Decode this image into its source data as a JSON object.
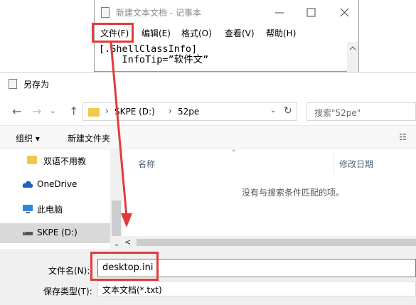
{
  "notepad": {
    "title": "新建文本文档 - 记事本",
    "menu": [
      "文件(F)",
      "编辑(E)",
      "格式(O)",
      "查看(V)",
      "帮助(H)"
    ],
    "lines": [
      "[.ShellClassInfo]",
      "    InfoTip=”软件文”"
    ],
    "controls": {
      "minimize": "—",
      "maximize": "☐",
      "close": "✕"
    }
  },
  "dialog": {
    "title": "另存为",
    "nav": {
      "back": "←",
      "forward": "→",
      "up": "↑"
    },
    "address": {
      "crumbs": [
        "SKPE (D:)",
        "52pe"
      ],
      "separator": "›",
      "dropdown": "⌄",
      "refresh": "↻"
    },
    "search_placeholder": "搜索\"52pe\"",
    "toolbar": {
      "organize": "组织 ▾",
      "new_folder": "新建文件夹",
      "view": "☷"
    },
    "nav_items": [
      {
        "label": "双语不用教",
        "icon": "folder-icon"
      },
      {
        "label": "OneDrive",
        "icon": "cloud-icon"
      },
      {
        "label": "此电脑",
        "icon": "computer-icon"
      },
      {
        "label": "SKPE (D:)",
        "icon": "drive-icon"
      }
    ],
    "columns": {
      "name": "名称",
      "date": "修改日期"
    },
    "empty_message": "没有与搜索条件匹配的项。",
    "filename_label": "文件名(N):",
    "filename_value": "desktop.ini",
    "filetype_label": "保存类型(T):",
    "filetype_value": "文本文档(*.txt)"
  },
  "colors": {
    "annotation": "#e23b3b",
    "folder": "#f2c94c",
    "onedrive": "#1e5fbf",
    "selected_bg": "#d9d9d9"
  }
}
